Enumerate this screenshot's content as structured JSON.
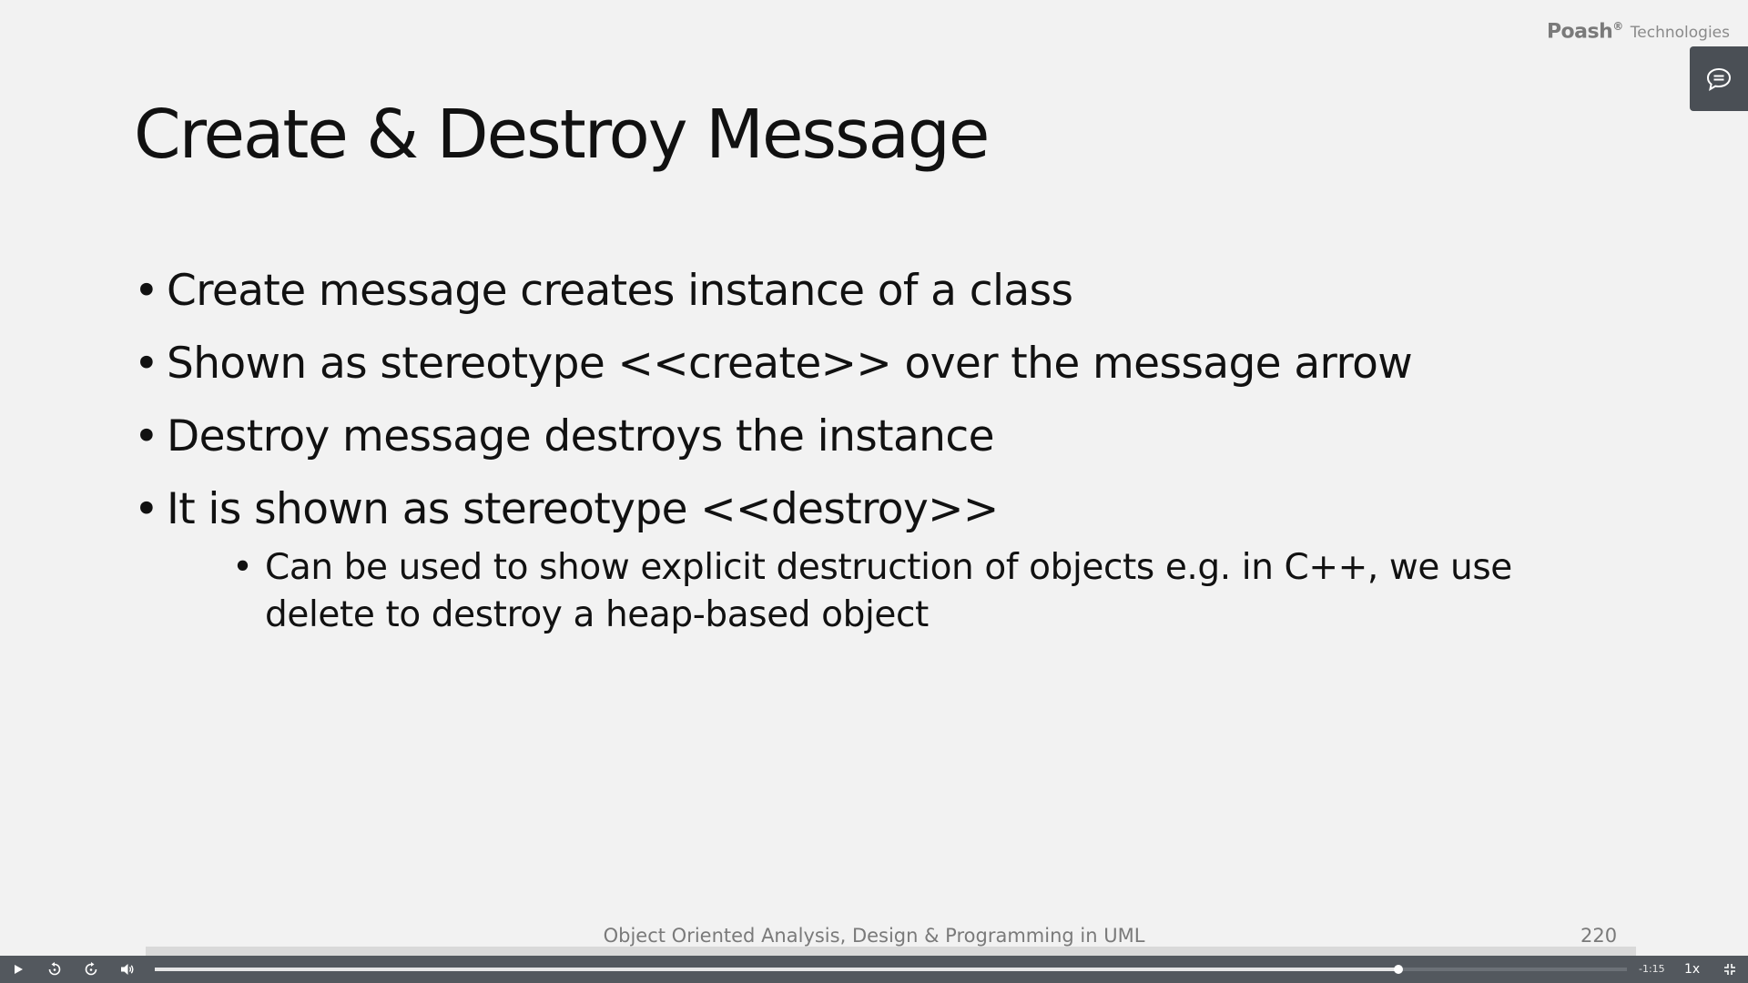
{
  "brand": {
    "name": "Poash",
    "mark": "®",
    "subtitle": "Technologies"
  },
  "slide": {
    "title": "Create & Destroy Message",
    "bullets": [
      {
        "text": "Create message creates instance of a class"
      },
      {
        "text": "Shown as stereotype <<create>> over the message arrow"
      },
      {
        "text": "Destroy message destroys the instance"
      },
      {
        "text": "It is shown as stereotype <<destroy>>",
        "sub": [
          {
            "text": "Can be used to show explicit destruction of objects e.g. in C++, we use delete to destroy a heap-based object"
          }
        ]
      }
    ],
    "bullet_glyph": "•",
    "footer": "Object Oriented Analysis, Design & Programming in UML",
    "page_number": "220"
  },
  "player": {
    "time_remaining": "-1:15",
    "speed": "1x",
    "progress": 0.845,
    "icons": {
      "play": "play-icon",
      "rewind": "rewind-icon",
      "forward": "forward-icon",
      "volume": "volume-icon",
      "fullscreen": "exit-fullscreen-icon",
      "comments": "comment-icon"
    }
  },
  "colors": {
    "background": "#f2f2f2",
    "text": "#111111",
    "muted": "#7a7a7a",
    "player_bar": "#53585e"
  }
}
